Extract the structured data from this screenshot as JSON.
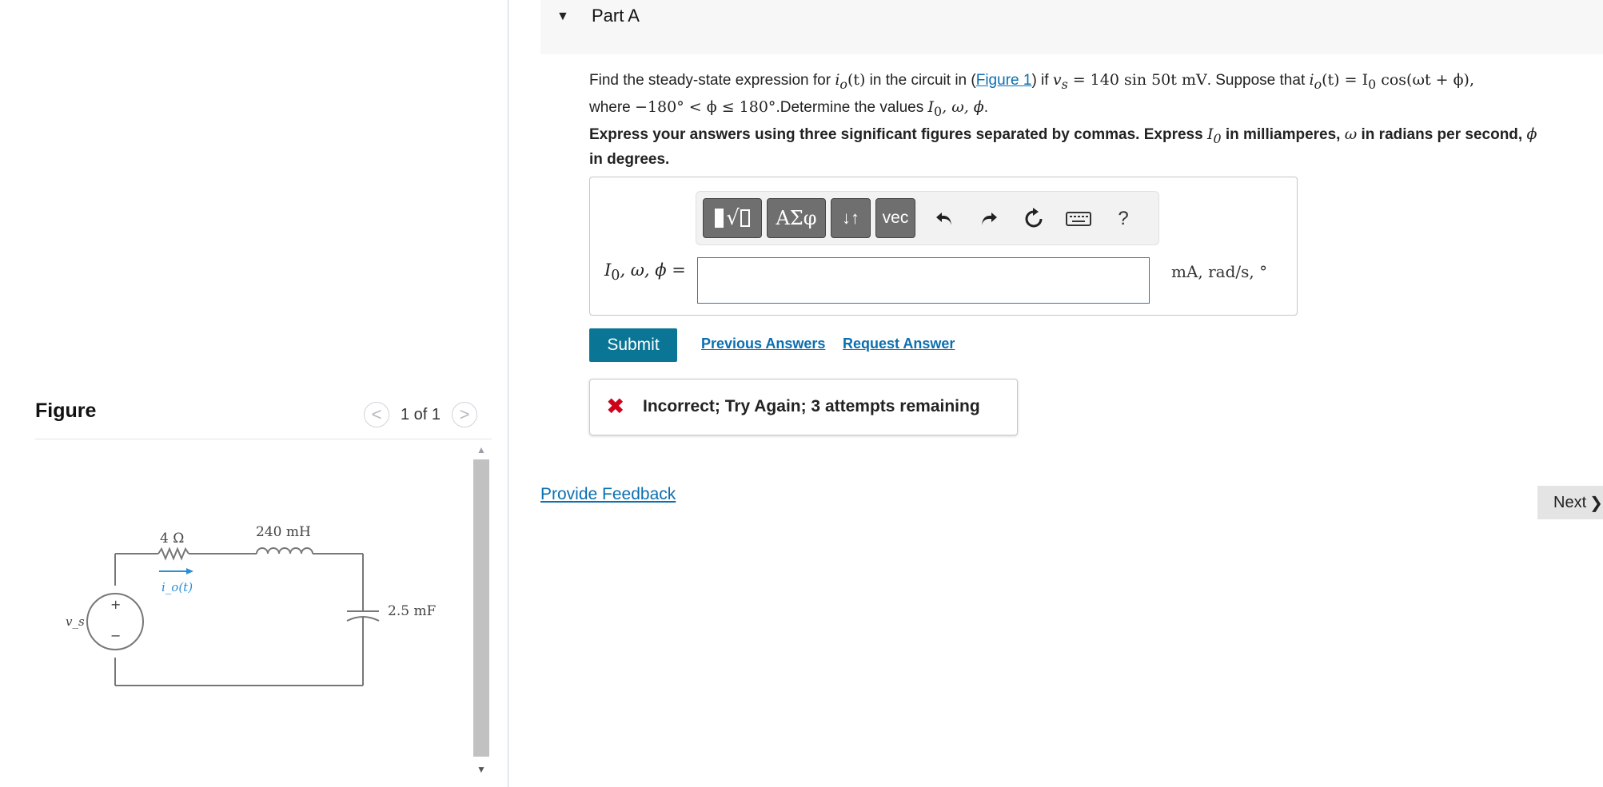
{
  "figure_panel": {
    "title": "Figure",
    "counter": "1 of 1",
    "prev_glyph": "<",
    "next_glyph": ">",
    "circuit": {
      "resistor_label": "4 Ω",
      "inductor_label": "240 mH",
      "capacitor_label": "2.5 mF",
      "current_label": "i_o(t)",
      "source_label": "v_s",
      "plus_sign": "+",
      "minus_sign": "−"
    },
    "scroll_up_glyph": "▲",
    "scroll_down_glyph": "▼"
  },
  "part": {
    "caret": "▼",
    "title": "Part A"
  },
  "question": {
    "text1": "Find the steady-state expression for ",
    "io_t": "i",
    "io_sub": "o",
    "paren_t": "(t)",
    "text2": " in the circuit in (",
    "figure_link": "Figure 1",
    "text3": ") if ",
    "vs": "v",
    "vs_sub": "s",
    "vs_expr": " = 140 sin 50t mV",
    "text4": ". Suppose that ",
    "io_expr": " = I",
    "io_expr_sub": "0",
    "io_expr_tail": " cos(ωt + ϕ),",
    "line2_text1": "where ",
    "range_expr": "−180° < ϕ ≤ 180°",
    "line2_text2": ".Determine the values ",
    "values_expr1": "I",
    "values_expr_sub": "0",
    "values_expr2": ", ω, ϕ",
    "line2_text3": "."
  },
  "instructions": {
    "line1_a": "Express your answers using three significant figures separated by commas. Express ",
    "I0": "I",
    "I0_sub": "0",
    "line1_b": " in milliamperes, ",
    "omega": "ω",
    "line1_c": " in radians per second, ",
    "phi": "ϕ",
    "line2": "in degrees."
  },
  "toolbar": {
    "templates_label": "√",
    "symbols_label": "ΑΣφ",
    "subscript_label": "↓↑",
    "vec_label": "vec",
    "help_label": "?"
  },
  "answer": {
    "label_I": "I",
    "label_sub": "0",
    "label_rest": ", ω, ϕ =",
    "value": "",
    "placeholder": "",
    "units": "mA, rad/s, °"
  },
  "actions": {
    "submit": "Submit",
    "previous_answers": "Previous Answers",
    "request_answer": "Request Answer"
  },
  "feedback": {
    "icon": "✖",
    "message": "Incorrect; Try Again; 3 attempts remaining"
  },
  "footer": {
    "provide_feedback": "Provide Feedback",
    "next": "Next",
    "next_glyph": "❯"
  },
  "colors": {
    "link": "#0b6fb0",
    "submit_bg": "#0b7596",
    "error": "#d0021b"
  }
}
